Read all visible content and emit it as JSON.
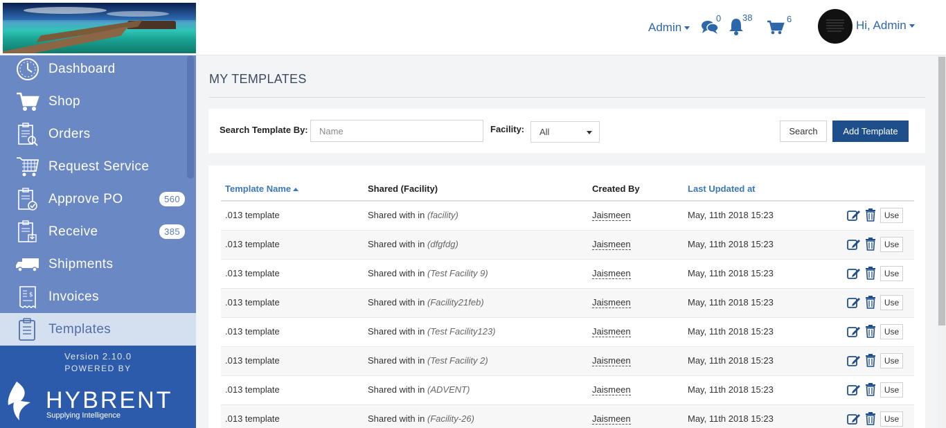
{
  "header": {
    "role_label": "Admin",
    "messages_count": "0",
    "notifications_count": "38",
    "cart_count": "6",
    "user_greeting": "Hi, Admin",
    "accent_color": "#2e67a8"
  },
  "sidebar": {
    "items": [
      {
        "label": "Dashboard",
        "icon": "dashboard-icon"
      },
      {
        "label": "Shop",
        "icon": "cart-icon"
      },
      {
        "label": "Orders",
        "icon": "orders-icon"
      },
      {
        "label": "Request Service",
        "icon": "request-service-icon"
      },
      {
        "label": "Approve PO",
        "icon": "approve-po-icon",
        "badge": "560"
      },
      {
        "label": "Receive",
        "icon": "receive-icon",
        "badge": "385"
      },
      {
        "label": "Shipments",
        "icon": "truck-icon"
      },
      {
        "label": "Invoices",
        "icon": "invoice-icon"
      },
      {
        "label": "Templates",
        "icon": "templates-icon",
        "active": true
      }
    ],
    "version": "Version 2.10.0",
    "powered_by": "POWERED BY",
    "brand": "HYBRENT",
    "tagline": "Supplying Intelligence",
    "bg_color": "#6a88c4",
    "footer_color": "#2d5bab"
  },
  "main": {
    "title": "MY TEMPLATES",
    "search": {
      "label": "Search Template By:",
      "placeholder": "Name",
      "facility_label": "Facility:",
      "facility_value": "All",
      "search_button": "Search",
      "add_button": "Add Template"
    },
    "table": {
      "columns": [
        "Template Name",
        "Shared (Facility)",
        "Created By",
        "Last Updated at"
      ],
      "rows": [
        {
          "name": ".013 template",
          "shared_prefix": "Shared with in",
          "facility": "(facility)",
          "created_by": "Jaismeen",
          "updated": "May, 11th 2018 15:23",
          "use": "Use"
        },
        {
          "name": ".013 template",
          "shared_prefix": "Shared with in",
          "facility": "(dfgfdg)",
          "created_by": "Jaismeen",
          "updated": "May, 11th 2018 15:23",
          "use": "Use"
        },
        {
          "name": ".013 template",
          "shared_prefix": "Shared with in",
          "facility": "(Test Facility 9)",
          "created_by": "Jaismeen",
          "updated": "May, 11th 2018 15:23",
          "use": "Use"
        },
        {
          "name": ".013 template",
          "shared_prefix": "Shared with in",
          "facility": "(Facility21feb)",
          "created_by": "Jaismeen",
          "updated": "May, 11th 2018 15:23",
          "use": "Use"
        },
        {
          "name": ".013 template",
          "shared_prefix": "Shared with in",
          "facility": "(Test Facility123)",
          "created_by": "Jaismeen",
          "updated": "May, 11th 2018 15:23",
          "use": "Use"
        },
        {
          "name": ".013 template",
          "shared_prefix": "Shared with in",
          "facility": "(Test Facility 2)",
          "created_by": "Jaismeen",
          "updated": "May, 11th 2018 15:23",
          "use": "Use"
        },
        {
          "name": ".013 template",
          "shared_prefix": "Shared with in",
          "facility": "(ADVENT)",
          "created_by": "Jaismeen",
          "updated": "May, 11th 2018 15:23",
          "use": "Use"
        },
        {
          "name": ".013 template",
          "shared_prefix": "Shared with in",
          "facility": "(Facility-26)",
          "created_by": "Jaismeen",
          "updated": "May, 11th 2018 15:23",
          "use": "Use"
        }
      ]
    },
    "primary_color": "#1f4f8a"
  }
}
